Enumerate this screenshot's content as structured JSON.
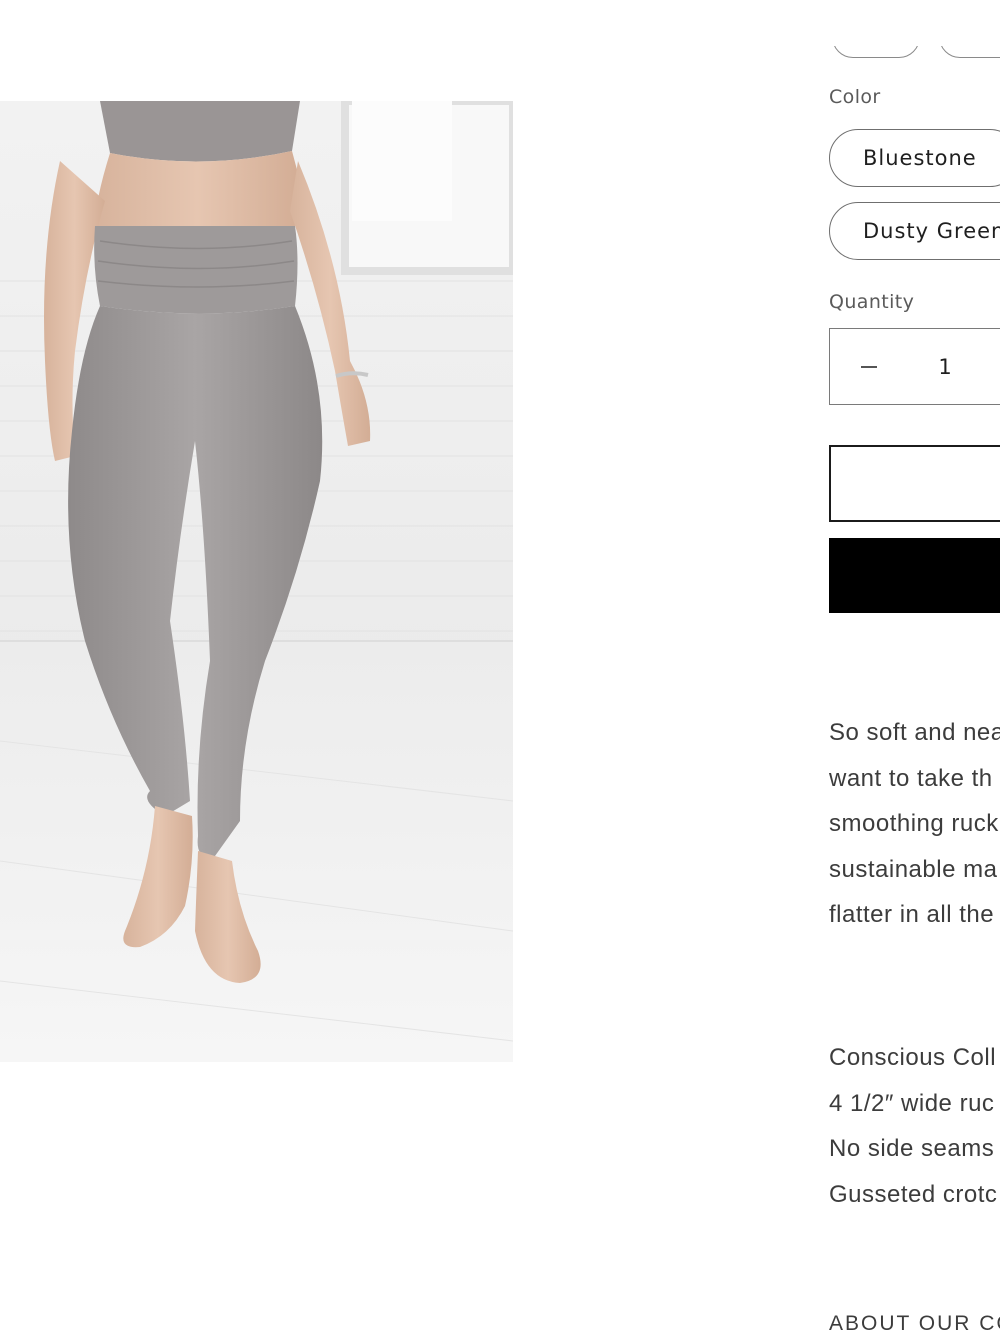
{
  "product": {
    "image_alt": "Woman wearing grey ruched high-waist leggings and matching top, barefoot in a white room",
    "colors": {
      "legging": "#9b9797",
      "background": "#f0f0f0",
      "accent": "#000000"
    }
  },
  "variants": {
    "color_label": "Color",
    "color_options": [
      "Bluestone",
      "Dusty Green"
    ]
  },
  "quantity": {
    "label": "Quantity",
    "value": "1",
    "decrease_icon": "minus-icon"
  },
  "buttons": {
    "add_to_cart_label": "",
    "buy_now_label": ""
  },
  "description": {
    "paragraph_lines": [
      "So soft and nea",
      "want to take th",
      "smoothing ruck",
      "sustainable ma",
      "flatter in all the"
    ],
    "feature_lines": [
      "Conscious Coll",
      "4 1/2″ wide ruc",
      "No side seams",
      "Gusseted crotc"
    ]
  },
  "about_heading": "ABOUT OUR CO"
}
